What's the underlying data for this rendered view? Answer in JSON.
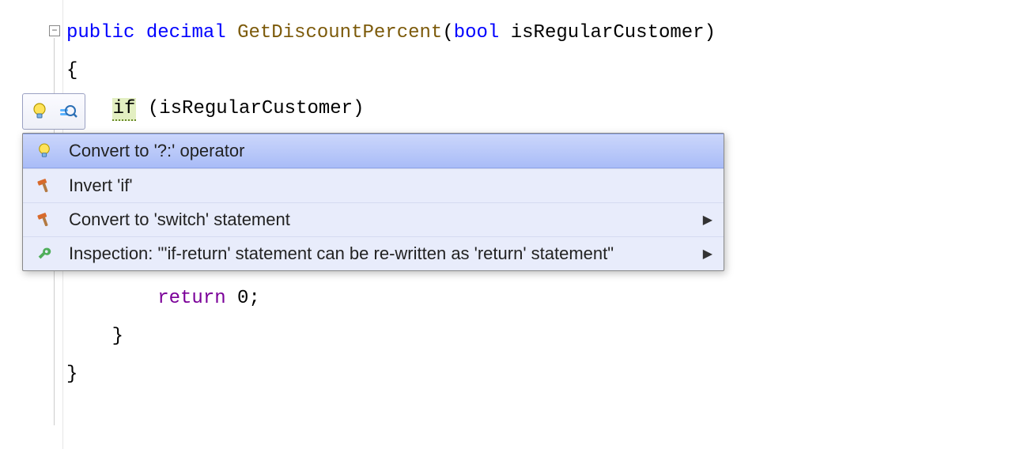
{
  "code": {
    "modifier": "public",
    "returnType": "decimal",
    "methodName": "GetDiscountPercent",
    "paramType": "bool",
    "paramName": "isRegularCustomer",
    "openBrace": "{",
    "closeBrace": "}",
    "ifKw": "if",
    "ifCondOpen": " (",
    "ifCondName": "isRegularCustomer",
    "ifCondClose": ")",
    "innerOpenBrace": "{",
    "innerCloseBrace": "}",
    "returnKw": "return",
    "returnVal": " 0;"
  },
  "popup": {
    "items": [
      {
        "label": "Convert to '?:' operator",
        "icon": "bulb",
        "submenu": false,
        "selected": true
      },
      {
        "label": "Invert 'if'",
        "icon": "hammer",
        "submenu": false,
        "selected": false
      },
      {
        "label": "Convert to 'switch' statement",
        "icon": "hammer",
        "submenu": true,
        "selected": false
      },
      {
        "label": "Inspection: \"'if-return' statement can be re-written as 'return' statement\"",
        "icon": "wrench",
        "submenu": true,
        "selected": false
      }
    ]
  }
}
